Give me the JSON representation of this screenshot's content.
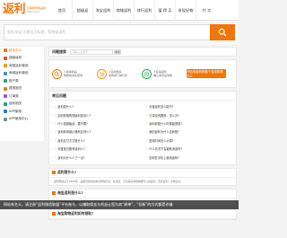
{
  "colors": {
    "accent": "#f0750a",
    "link": "#333333"
  },
  "header": {
    "logo_mark": "返利",
    "logo_tag": "互联网导购品牌",
    "logo_url": "Fanli.com",
    "nav": [
      "首页",
      "超级返",
      "淘宝返利",
      "商城返利",
      "排行返利",
      "值 得 买",
      "发现好物",
      "特 卖"
    ]
  },
  "search": {
    "placeholder": "粘贴淘宝/天猫宝贝标题，购物省返利",
    "button_icon": "search-icon"
  },
  "sidebar": {
    "items": [
      {
        "label": "新手中心",
        "icon": "home-icon",
        "color": "#f0750a",
        "active": true
      },
      {
        "label": "超级返利",
        "icon": "star-icon",
        "color": "#e74c3c"
      },
      {
        "label": "淘宝返利使用",
        "icon": "tag-icon",
        "color": "#f39c12"
      },
      {
        "label": "商城返利使用",
        "icon": "cart-icon",
        "color": "#3498db"
      },
      {
        "label": "账户类",
        "icon": "user-icon",
        "color": "#27ae60"
      },
      {
        "label": "提现相关",
        "icon": "money-icon",
        "color": "#e67e22"
      },
      {
        "label": "订单类",
        "icon": "order-icon",
        "color": "#9b59b6"
      },
      {
        "label": "返利相关",
        "icon": "coin-icon",
        "color": "#16a085"
      },
      {
        "label": "APP使用",
        "icon": "phone-icon",
        "color": "#2980b9"
      },
      {
        "label": "APP使用中心",
        "icon": "app-icon",
        "color": "#7f8c8d"
      }
    ]
  },
  "help_search": {
    "label": "问题搜索",
    "placeholder": "请输入关键字",
    "button": "搜索"
  },
  "steps": {
    "items": [
      {
        "line1": "①选择商品",
        "line2": "购物前请先登录",
        "icon": "search-icon",
        "color": "#f0750a"
      },
      {
        "line1": "②完成购买",
        "line2": "到商城下单付款",
        "icon": "cart-icon",
        "color": "#f39c12"
      },
      {
        "line1": "③获得返利",
        "line2": "确认收货后到账",
        "icon": "coin-icon",
        "color": "#27ae60"
      }
    ],
    "cta": "开始淘宝购物做个省钱购物达人"
  },
  "faq": {
    "title": "常见问题",
    "links": [
      "返利是什么?",
      "淘宝返利怎么能不?",
      "如何获取购物返利是多少?",
      "订单没有跟踪，怎么办?",
      "什么是超级返，要不要?",
      "返利到账什么时候能提现?",
      "返利和商城价格有区别么?",
      "我的返利为什么没到账?",
      "返利支付方式是什么?",
      "提现时间怎么计算?",
      "淘宝宝贝都有返利么?",
      "什么情况下会被取消返利?",
      "返利为什么少了一点?",
      "如何在手机上使用返利?"
    ]
  },
  "qa": [
    {
      "title": "返利是什么?",
      "body": "返利网成立于2006年，是国内领先的电商导购平台，在淘宝、京东等商城购物都可以拿返利，现金返利，全网比价。"
    },
    {
      "title": "淘宝返利是什么?",
      "body": "通过返利网去淘宝购物，购买成功后可获得一定比例的现金返利。"
    },
    {
      "title": "淘宝购物返利如何领取?",
      "body": ""
    }
  ],
  "overlay_text": "网站有名义，请注册“返利微信联盟”平台账号，以赚取佣金为利益让您为其“刷单”，“拉新”的方式都是诈骗"
}
